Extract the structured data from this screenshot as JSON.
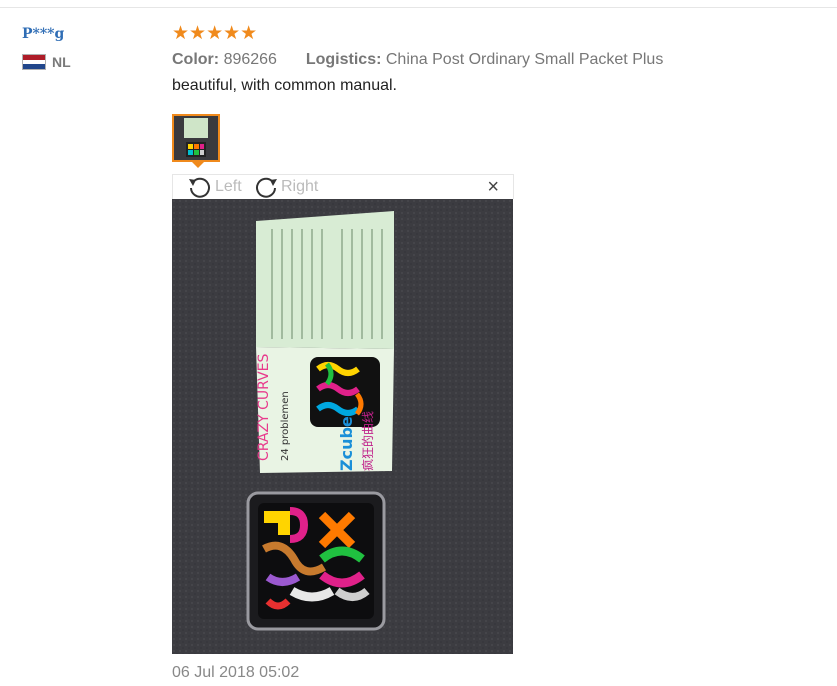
{
  "user": {
    "name": "P***g",
    "country": "NL"
  },
  "review": {
    "stars": "★★★★★",
    "color_label": "Color:",
    "color_value": "896266",
    "logistics_label": "Logistics:",
    "logistics_value": "China Post Ordinary Small Packet Plus",
    "text": "beautiful, with common manual.",
    "date": "06 Jul 2018 05:02"
  },
  "viewer": {
    "rotate_left": "Left",
    "rotate_right": "Right",
    "close": "×"
  },
  "photo": {
    "manual_cover": {
      "title_left": "CRAZY CURVES",
      "subtitle": "24 problemen",
      "brand": "Zcube",
      "chinese": "疯狂的曲线"
    }
  },
  "colors": {
    "accent": "#f08a1c",
    "link": "#2f6db5",
    "flag": [
      "#ae1c28",
      "#ffffff",
      "#21468b"
    ]
  },
  "icons": [
    "rotate-left-icon",
    "rotate-right-icon",
    "close-icon",
    "flag-nl-icon"
  ]
}
